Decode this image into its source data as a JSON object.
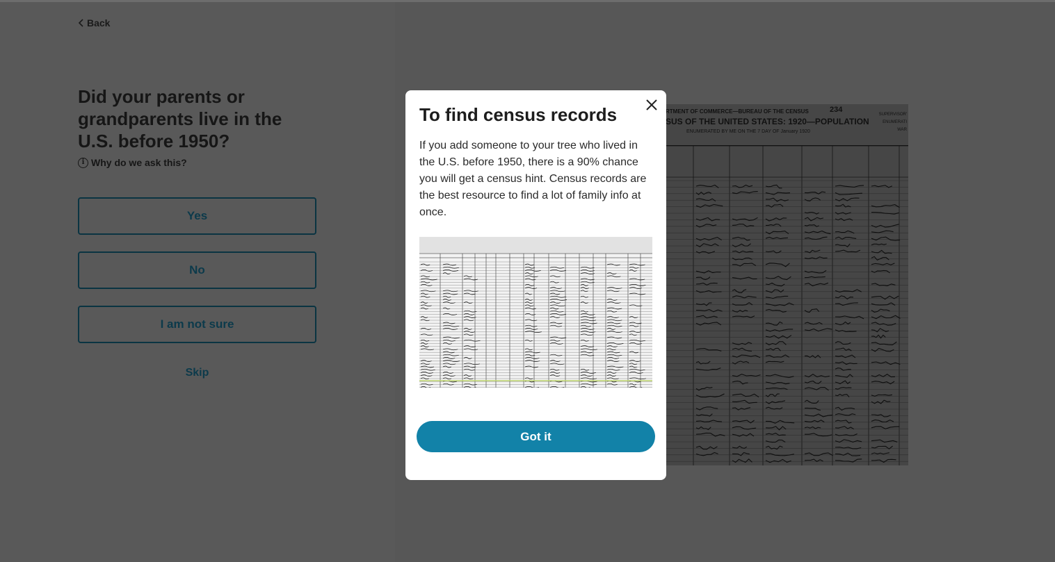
{
  "nav": {
    "back_label": "Back"
  },
  "question": {
    "title": "Did your parents or grandparents live in the U.S. before 1950?",
    "why_label": "Why do we ask this?"
  },
  "options": [
    {
      "label": "Yes"
    },
    {
      "label": "No"
    },
    {
      "label": "I am not sure"
    }
  ],
  "skip_label": "Skip",
  "background_image": {
    "line1": "RTMENT OF COMMERCE—BUREAU OF THE CENSUS",
    "line2": "SUS OF THE UNITED STATES: 1920—POPULATION",
    "line3": "ENUMERATED BY ME ON THE 7 DAY OF January 1920",
    "sheet_number": "234",
    "side_labels": [
      "SUPERVISOR'",
      "ENUMERATI",
      "WAR"
    ]
  },
  "modal": {
    "title": "To find census records",
    "body": "If you add someone to your tree who lived in the U.S. before 1950, there is a 90% chance you will get a census hint. Census records are the best resource to find a lot of family info at once.",
    "button_label": "Got it"
  },
  "colors": {
    "accent": "#1282a8",
    "option_border": "#0a3442",
    "overlay": "#595959"
  }
}
